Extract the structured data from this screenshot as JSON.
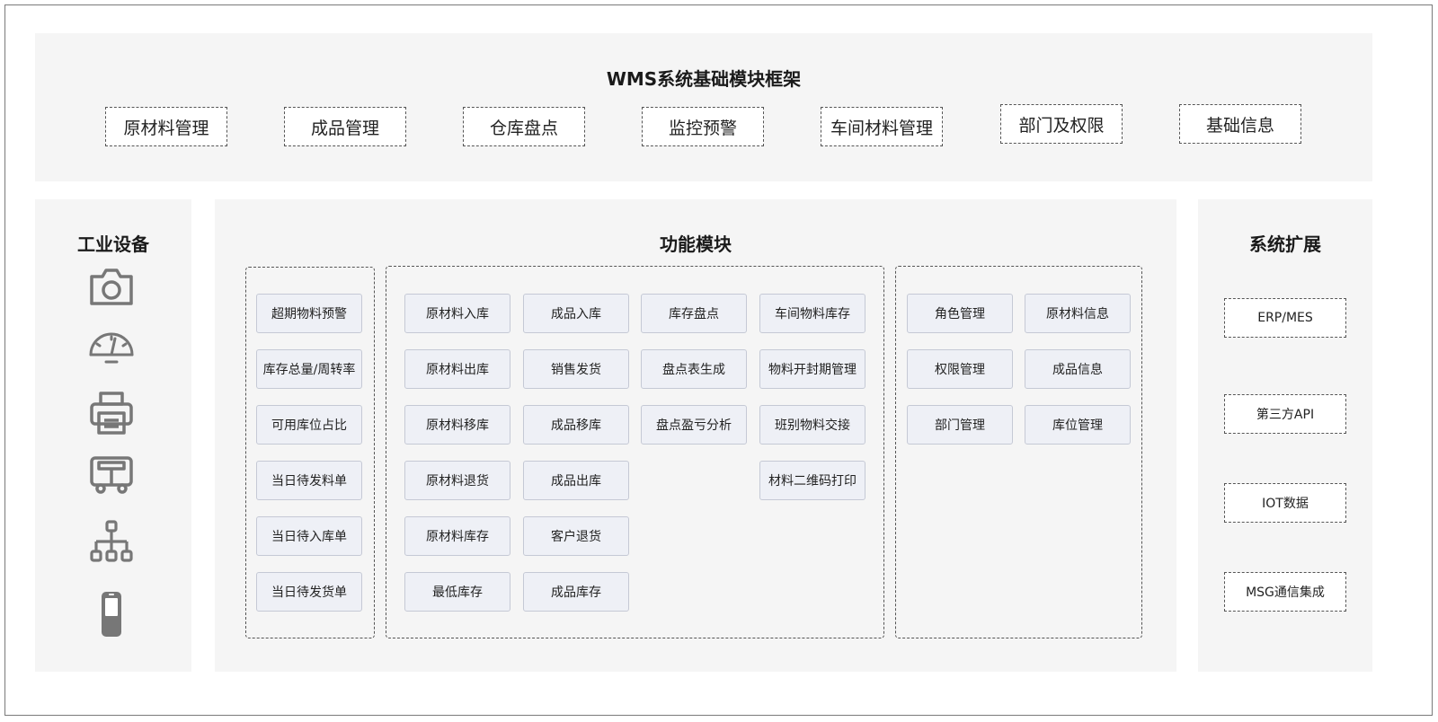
{
  "framework": {
    "title": "WMS系统基础模块框架",
    "modules": [
      "原材料管理",
      "成品管理",
      "仓库盘点",
      "监控预警",
      "车间材料管理",
      "部门及权限",
      "基础信息"
    ]
  },
  "equipment": {
    "title": "工业设备",
    "icons": [
      "camera-icon",
      "gauge-icon",
      "printer-icon",
      "vehicle-icon",
      "hierarchy-icon",
      "handheld-scanner-icon"
    ]
  },
  "functions": {
    "title": "功能模块",
    "monitor": [
      "超期物料预警",
      "库存总量/周转率",
      "可用库位占比",
      "当日待发料单",
      "当日待入库单",
      "当日待发货单"
    ],
    "warehouse": [
      [
        "原材料入库",
        "原材料出库",
        "原材料移库",
        "原材料退货",
        "原材料库存",
        "最低库存"
      ],
      [
        "成品入库",
        "销售发货",
        "成品移库",
        "成品出库",
        "客户退货",
        "成品库存"
      ],
      [
        "库存盘点",
        "盘点表生成",
        "盘点盈亏分析"
      ],
      [
        "车间物料库存",
        "物料开封期管理",
        "班别物料交接",
        "材料二维码打印"
      ]
    ],
    "admin": [
      [
        "角色管理",
        "权限管理",
        "部门管理"
      ],
      [
        "原材料信息",
        "成品信息",
        "库位管理"
      ]
    ]
  },
  "extension": {
    "title": "系统扩展",
    "items": [
      "ERP/MES",
      "第三方API",
      "IOT数据",
      "MSG通信集成"
    ]
  }
}
